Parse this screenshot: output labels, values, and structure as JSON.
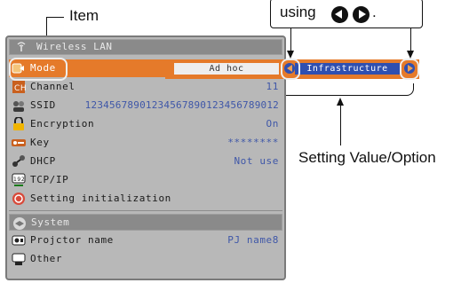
{
  "callouts": {
    "item_label": "Item",
    "using_label": "using",
    "using_suffix": ".",
    "setting_label": "Setting Value/Option"
  },
  "menu": {
    "title": "Wireless LAN",
    "rows": [
      {
        "label": "Mode",
        "value": "",
        "icon": "mode-icon"
      },
      {
        "label": "Channel",
        "value": "11",
        "icon": "channel-icon"
      },
      {
        "label": "SSID",
        "value": "12345678901234567890123456789012",
        "icon": "ssid-icon"
      },
      {
        "label": "Encryption",
        "value": "On",
        "icon": "lock-icon"
      },
      {
        "label": "Key",
        "value": "********",
        "icon": "key-icon"
      },
      {
        "label": "DHCP",
        "value": "Not use",
        "icon": "dhcp-icon"
      },
      {
        "label": "TCP/IP",
        "value": "",
        "icon": "tcpip-icon"
      },
      {
        "label": "Setting initialization",
        "value": "",
        "icon": "reset-icon"
      }
    ],
    "system_header": "System",
    "rows2": [
      {
        "label": "Projctor name",
        "value": "PJ name8",
        "icon": "projector-icon"
      },
      {
        "label": "Other",
        "value": "",
        "icon": "other-icon"
      }
    ]
  },
  "mode_options": {
    "option1": "Ad hoc",
    "option2": "Infrastructure"
  },
  "colors": {
    "accent": "#e57a2a",
    "selected_option": "#2f4fb0",
    "value_text": "#3f57a8",
    "panel": "#b8b8b8"
  }
}
